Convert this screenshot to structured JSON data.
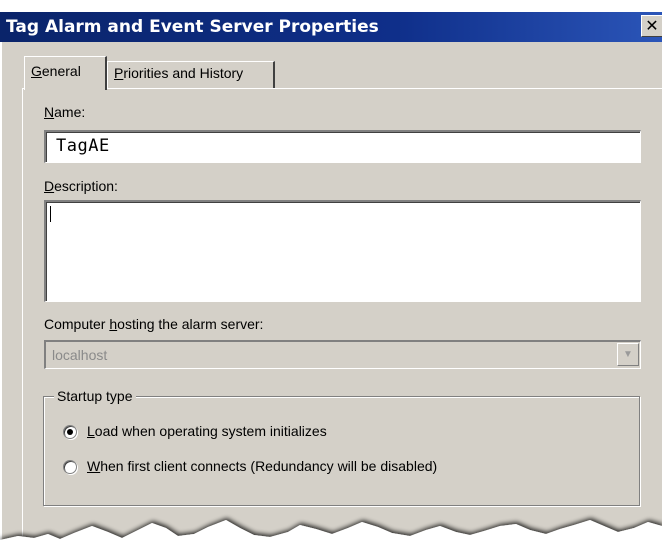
{
  "window": {
    "title": "Tag Alarm and Event Server Properties",
    "close_glyph": "✕"
  },
  "tabs": [
    {
      "label_accel": "G",
      "label_rest": "eneral",
      "active": true
    },
    {
      "label_accel": "P",
      "label_rest": "riorities and History",
      "active": false
    }
  ],
  "general": {
    "name_label_accel": "N",
    "name_label_rest": "ame:",
    "name_value": "TagAE",
    "description_label_accel": "D",
    "description_label_rest": "escription:",
    "description_value": "",
    "computer_label_pre": "Computer ",
    "computer_label_accel": "h",
    "computer_label_rest": "osting the alarm server:",
    "computer_value": "localhost",
    "computer_disabled": true,
    "startup": {
      "legend": "Startup type",
      "options": [
        {
          "label_accel": "L",
          "label_rest": "oad when operating system initializes",
          "selected": true
        },
        {
          "label_accel": "W",
          "label_rest": "hen first client connects (Redundancy will be disabled)",
          "selected": false
        }
      ]
    }
  },
  "colors": {
    "titlebar": "#0a246a",
    "face": "#d4d0c8",
    "disabled_text": "#8a8a8a"
  },
  "icons": {
    "close": "close-icon",
    "combo_arrow": "chevron-down-icon"
  }
}
